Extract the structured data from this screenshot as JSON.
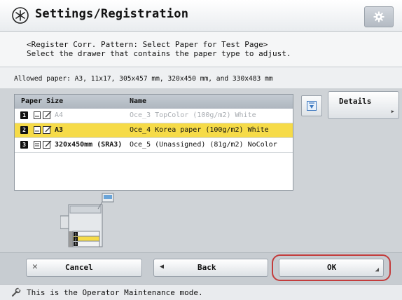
{
  "header": {
    "title": "Settings/Registration"
  },
  "instructions": {
    "line1": "<Register Corr. Pattern: Select Paper for Test Page>",
    "line2": "Select the drawer that contains the paper type to adjust."
  },
  "allowed_paper": "Allowed paper: A3, 11x17, 305x457 mm, 320x450 mm, and 330x483 mm",
  "paper_list": {
    "columns": [
      "Paper Size",
      "Name"
    ],
    "rows": [
      {
        "drawer": "1",
        "size": "A4",
        "name": "Oce_3 TopColor (100g/m2) White",
        "state": "disabled"
      },
      {
        "drawer": "2",
        "size": "A3",
        "name": "Oce_4 Korea paper (100g/m2) White",
        "state": "selected"
      },
      {
        "drawer": "3",
        "size": "320x450mm (SRA3)",
        "name": "Oce_5 (Unassigned) (81g/m2) NoColor",
        "state": "enabled"
      }
    ]
  },
  "buttons": {
    "details": "Details",
    "cancel": "Cancel",
    "back": "Back",
    "ok": "OK"
  },
  "printer_drawers": [
    "1",
    "2",
    "3"
  ],
  "status": "This is the Operator Maintenance mode.",
  "colors": {
    "selected_row": "#f6db48",
    "ok_highlight": "#c33c3c"
  },
  "icons": [
    "settings-app-icon",
    "gear-icon",
    "paper-stack-icon",
    "edit-paper-icon",
    "scroll-down-icon",
    "cancel-x-icon",
    "back-arrow-icon",
    "wrench-icon"
  ]
}
